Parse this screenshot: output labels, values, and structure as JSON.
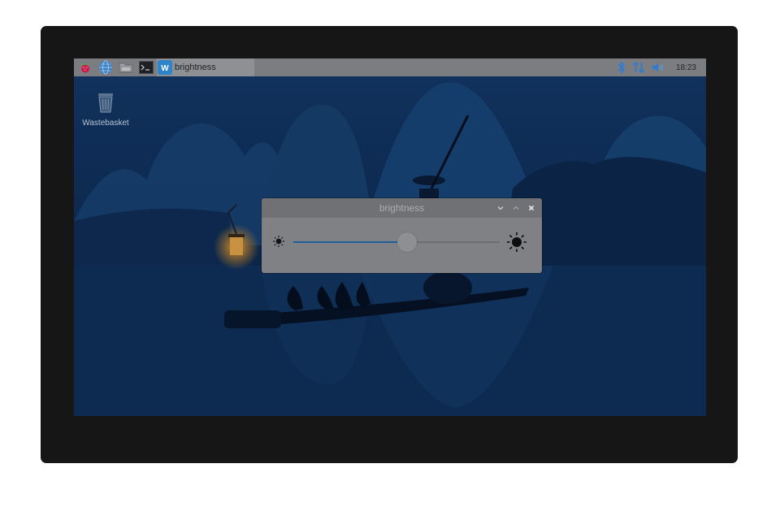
{
  "taskbar": {
    "launchers": [
      {
        "icon": "raspberry-menu-icon"
      },
      {
        "icon": "web-browser-icon"
      },
      {
        "icon": "file-manager-icon"
      },
      {
        "icon": "terminal-icon"
      }
    ],
    "active_task": {
      "icon": "brightness-app-icon",
      "label": "brightness"
    },
    "tray": {
      "icons": [
        "bluetooth-icon",
        "network-icon",
        "volume-icon"
      ],
      "clock": "18:23",
      "accent_color": "#2f7bd4"
    }
  },
  "desktop": {
    "icons": [
      {
        "label": "Wastebasket",
        "icon": "wastebasket-icon"
      }
    ]
  },
  "dialog": {
    "title": "brightness",
    "controls": [
      "minimize",
      "maximize",
      "close"
    ],
    "slider": {
      "min_icon": "sun-small-icon",
      "max_icon": "sun-large-icon",
      "value_percent": 55,
      "accent_color": "#1f5f9e"
    }
  }
}
